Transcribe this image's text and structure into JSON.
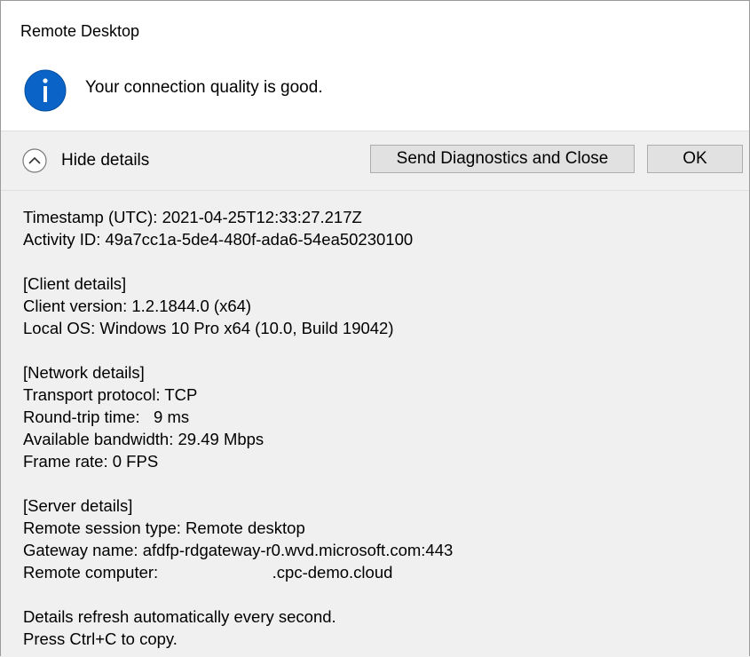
{
  "window": {
    "title": "Remote Desktop"
  },
  "message": {
    "text": "Your connection quality is good.",
    "icon": "info-icon",
    "icon_color": "#0a64c8"
  },
  "toolbar": {
    "toggle_label": "Hide details",
    "toggle_icon": "chevron-up-icon",
    "send_label": "Send Diagnostics and Close",
    "ok_label": "OK"
  },
  "details": {
    "timestamp": "Timestamp (UTC): 2021-04-25T12:33:27.217Z",
    "activity_id": "Activity ID: 49a7cc1a-5de4-480f-ada6-54ea50230100",
    "client": {
      "header": "[Client details]",
      "version": "Client version: 1.2.1844.0 (x64)",
      "local_os": "Local OS: Windows 10 Pro x64 (10.0, Build 19042)"
    },
    "network": {
      "header": "[Network details]",
      "transport": "Transport protocol: TCP",
      "rtt": "Round-trip time:   9 ms",
      "bandwidth": "Available bandwidth: 29.49 Mbps",
      "frame_rate": "Frame rate: 0 FPS"
    },
    "server": {
      "header": "[Server details]",
      "session_type": "Remote session type: Remote desktop",
      "gateway": "Gateway name: afdfp-rdgateway-r0.wvd.microsoft.com:443",
      "remote_computer": "Remote computer:                         .cpc-demo.cloud"
    },
    "footer": {
      "refresh": "Details refresh automatically every second.",
      "copy_hint": "Press Ctrl+C to copy."
    }
  }
}
